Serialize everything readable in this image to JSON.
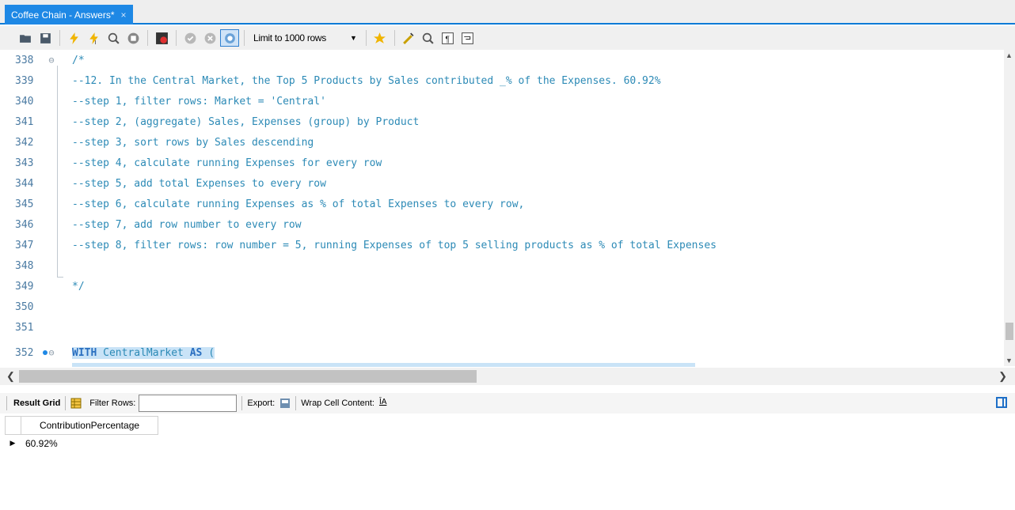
{
  "tab": {
    "title": "Coffee Chain - Answers*",
    "close": "×"
  },
  "toolbar": {
    "limit_label": "Limit to 1000 rows",
    "icons": [
      "open-folder-icon",
      "save-icon",
      "execute-icon",
      "execute-current-icon",
      "explain-icon",
      "stop-icon",
      "toggle-error-icon",
      "commit-icon",
      "rollback-icon",
      "autocommit-icon",
      "limit-dropdown",
      "bookmark-icon",
      "beautify-icon",
      "find-icon",
      "invisible-chars-icon",
      "wrap-icon"
    ]
  },
  "editor": {
    "lines": [
      {
        "num": "338",
        "text": "/*"
      },
      {
        "num": "339",
        "text": "--12. In the Central Market, the Top 5 Products by Sales contributed _% of the Expenses. 60.92%"
      },
      {
        "num": "340",
        "text": "--step 1, filter rows: Market = 'Central'"
      },
      {
        "num": "341",
        "text": "--step 2, (aggregate) Sales, Expenses (group) by Product"
      },
      {
        "num": "342",
        "text": "--step 3, sort rows by Sales descending"
      },
      {
        "num": "343",
        "text": "--step 4, calculate running Expenses for every row"
      },
      {
        "num": "344",
        "text": "--step 5, add total Expenses to every row"
      },
      {
        "num": "345",
        "text": "--step 6, calculate running Expenses as % of total Expenses to every row,"
      },
      {
        "num": "346",
        "text": "--step 7, add row number to every row"
      },
      {
        "num": "347",
        "text": "--step 8, filter rows: row number = 5, running Expenses of top 5 selling products as % of total Expenses"
      },
      {
        "num": "348",
        "text": ""
      },
      {
        "num": "349",
        "text": "*/"
      },
      {
        "num": "350",
        "text": ""
      },
      {
        "num": "351",
        "text": ""
      },
      {
        "num": "352",
        "kw1": "WITH",
        "mid": " CentralMarket ",
        "kw2": "AS",
        "tail": " ("
      }
    ]
  },
  "result_toolbar": {
    "result_grid": "Result Grid",
    "filter_rows": "Filter Rows:",
    "filter_value": "",
    "export": "Export:",
    "wrap": "Wrap Cell Content:"
  },
  "grid": {
    "columns": [
      "ContributionPercentage"
    ],
    "rows": [
      [
        "60.92%"
      ]
    ]
  }
}
